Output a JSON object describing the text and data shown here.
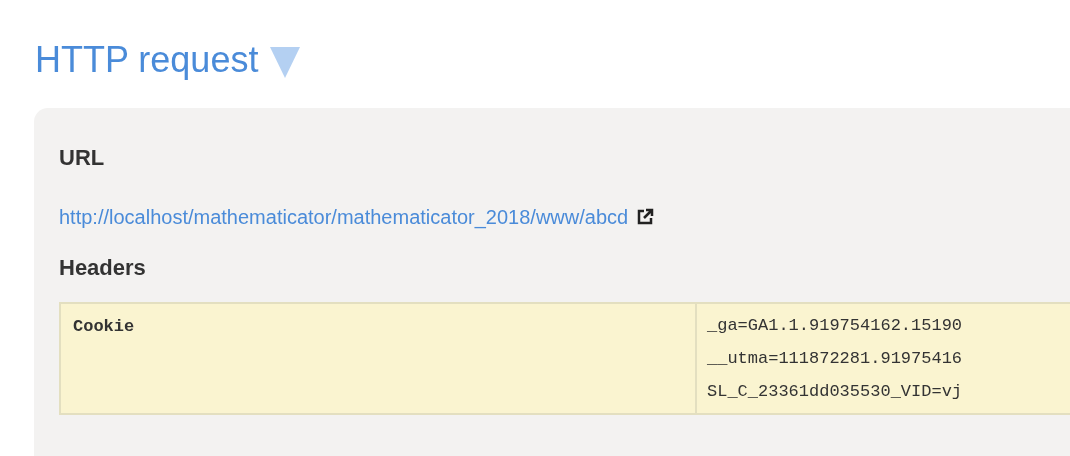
{
  "title": "HTTP request",
  "expanded": true,
  "url": {
    "label": "URL",
    "link": "http://localhost/mathematicator/mathematicator_2018/www/abcd"
  },
  "headers": {
    "label": "Headers",
    "rows": [
      {
        "name": "Cookie",
        "values": [
          "_ga=GA1.1.919754162.15190",
          "__utma=111872281.91975416",
          "SL_C_23361dd035530_VID=vj"
        ]
      }
    ]
  }
}
